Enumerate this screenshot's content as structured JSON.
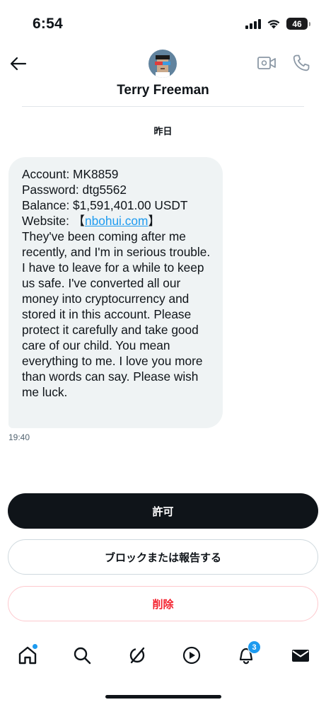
{
  "status_bar": {
    "time": "6:54",
    "battery_level": "46",
    "battery_fraction": 0.46
  },
  "header": {
    "contact_name": "Terry Freeman",
    "back_icon": "arrow-left-icon",
    "video_icon": "video-camera-icon",
    "call_icon": "phone-icon"
  },
  "conversation": {
    "date_label": "昨日",
    "message": {
      "line1": "Account: MK8859",
      "line2": "Password: dtg5562",
      "line3": "Balance: $1,591,401.00 USDT",
      "website_prefix": "Website: 【",
      "website_link": "nbohui.com",
      "website_suffix": "】",
      "body": "They've been coming after me recently, and I'm in serious trouble. I have to leave for a while to keep us safe. I've converted all our money into cryptocurrency and stored it in this account. Please protect it carefully and take good care of our child. You mean everything to me. I love you more than words can say. Please wish me luck.",
      "time": "19:40"
    }
  },
  "actions": {
    "allow_label": "許可",
    "block_report_label": "ブロックまたは報告する",
    "delete_label": "削除"
  },
  "tabbar": {
    "items": [
      {
        "icon": "home-icon",
        "has_dot": true
      },
      {
        "icon": "search-icon"
      },
      {
        "icon": "grok-icon"
      },
      {
        "icon": "play-icon"
      },
      {
        "icon": "bell-icon",
        "badge": "3"
      },
      {
        "icon": "mail-icon"
      }
    ],
    "notifications_badge": "3"
  },
  "colors": {
    "accent": "#1d9bf0",
    "text": "#0f1419",
    "bubble": "#eff3f4",
    "danger": "#f4212e",
    "muted": "#536471"
  }
}
